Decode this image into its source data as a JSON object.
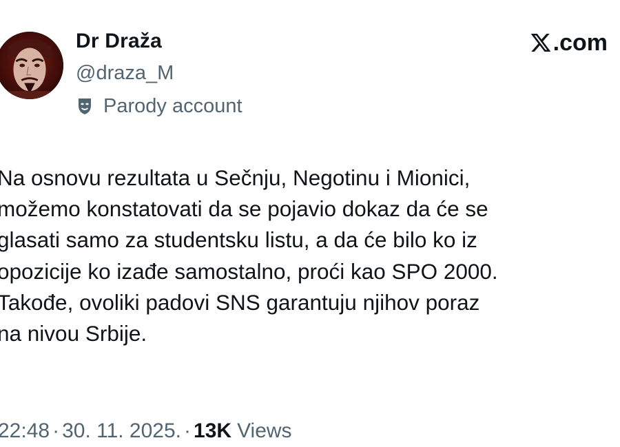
{
  "author": {
    "display_name": "Dr Draža",
    "handle": "@draza_M",
    "parody_label": "Parody account",
    "parody_icon": "theater-mask-icon",
    "avatar_icon": "profile-avatar"
  },
  "brand": {
    "text": ".com",
    "icon": "x-logo-icon"
  },
  "tweet": {
    "lines": [
      "Na osnovu rezultata u Sečnju, Negotinu i Mionici,",
      "možemo konstatovati da se pojavio dokaz da će se",
      "glasati samo za studentsku listu, a da će bilo ko iz",
      "opozicije ko izađe samostalno, proći kao SPO 2000.",
      "Takođe, ovoliki padovi SNS garantuju njihov poraz",
      "na nivou Srbije."
    ]
  },
  "meta": {
    "time": "22:48",
    "separator": "·",
    "date": "30. 11. 2025.",
    "views_count": "13K",
    "views_label": "Views"
  },
  "colors": {
    "text_primary": "#0f1419",
    "text_secondary": "#536471",
    "background": "#ffffff"
  }
}
